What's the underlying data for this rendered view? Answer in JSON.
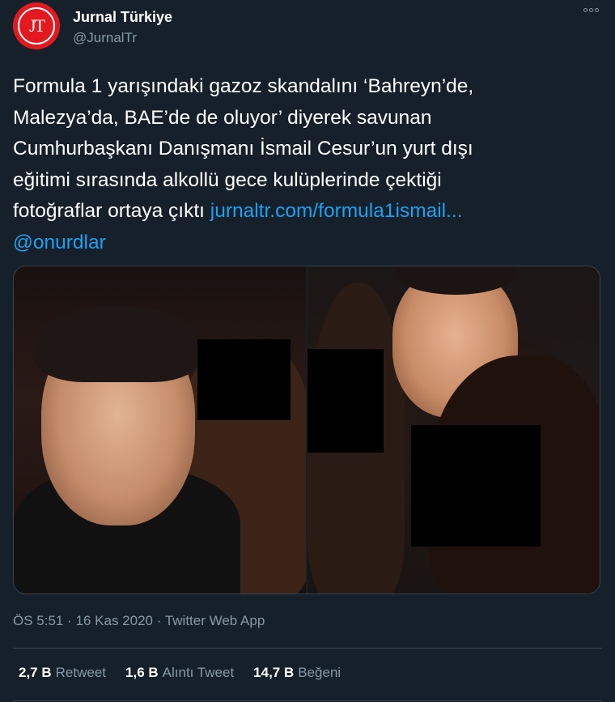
{
  "account": {
    "avatar_text": "JT",
    "display_name": "Jurnal Türkiye",
    "handle": "@JurnalTr",
    "brand_color": "#e3191f"
  },
  "tweet": {
    "lines": [
      "Formula 1 yarışındaki gazoz skandalını ‘Bahreyn’de,",
      "Malezya’da, BAE’de de oluyor’ diyerek savunan",
      "Cumhurbaşkanı Danışmanı İsmail Cesur’un yurt dışı",
      "eğitimi sırasında alkollü gece kulüplerinde çektiği"
    ],
    "last_line_text": "fotoğraflar ortaya çıktı",
    "link": "jurnaltr.com/formula1ismail...",
    "mention": "@onurdlar"
  },
  "media": {
    "photos": [
      "photo-left",
      "photo-right"
    ],
    "censor_color": "#000000"
  },
  "meta": {
    "time": "ÖS 5:51",
    "date": "16 Kas 2020",
    "source": "Twitter Web App",
    "separator": "·"
  },
  "stats": {
    "retweets": {
      "count": "2,7 B",
      "label": "Retweet"
    },
    "quotes": {
      "count": "1,6 B",
      "label": "Alıntı Tweet"
    },
    "likes": {
      "count": "14,7 B",
      "label": "Beğeni"
    }
  },
  "colors": {
    "background": "#15202b",
    "link": "#1da1f2",
    "secondary_text": "#8899a6",
    "border": "#38444d"
  },
  "icons": [
    "more-options-icon"
  ]
}
